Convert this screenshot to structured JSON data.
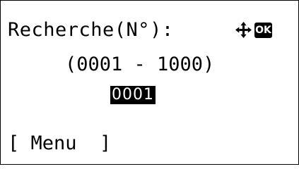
{
  "screen": {
    "title": "Recherche(N°):",
    "range": "(0001 - 1000)",
    "value": "0001",
    "ok_label": "OK",
    "nav_icon": "four-way-arrow-icon"
  },
  "softkeys": {
    "left_label": "[ Menu  ]"
  }
}
